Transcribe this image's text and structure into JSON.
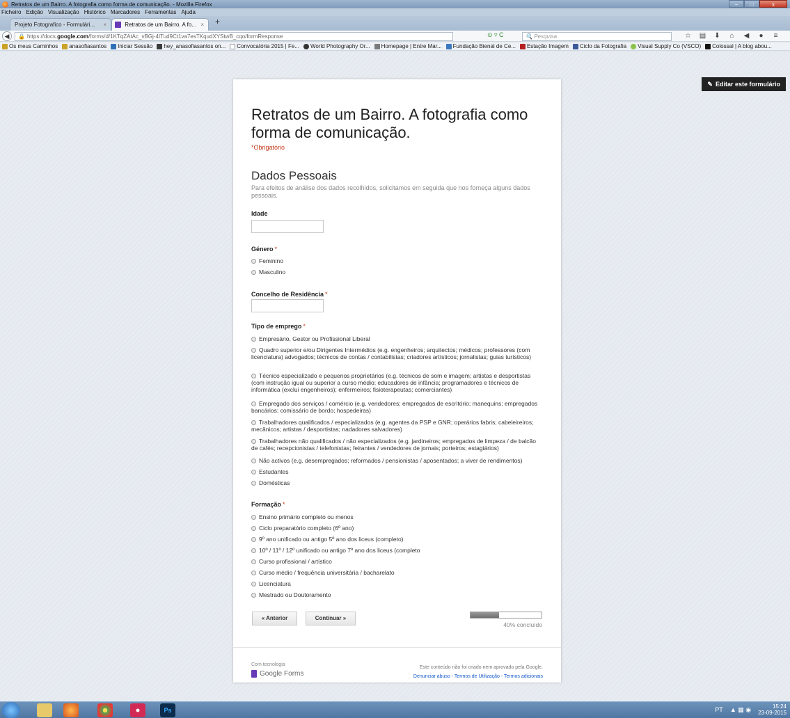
{
  "window": {
    "title": "Retratos de um Bairro. A fotografia como forma de comunicação. - Mozilla Firefox",
    "min": "–",
    "max": "□",
    "close": "x"
  },
  "menu": [
    "Ficheiro",
    "Edição",
    "Visualização",
    "Histórico",
    "Marcadores",
    "Ferramentas",
    "Ajuda"
  ],
  "tabs": [
    {
      "label": "Projeto Fotografico - Formulári..."
    },
    {
      "label": "Retratos de um Bairro. A fo..."
    }
  ],
  "tab_close": "×",
  "new_tab": "+",
  "nav": {
    "back_icon": "arrow-left",
    "url_prefix": "https://docs.",
    "url_domain": "google.com",
    "url_rest": "/forms/d/1KTqZAtAc_vBGj-4ITud9Ct1va7esTKqudXYStwB_cqo/formResponse",
    "url_actions": "⊙ ▿ C",
    "search_placeholder": "Pesquisa",
    "icons": [
      "☆",
      "▤",
      "⬇",
      "⌂",
      "◀",
      "●",
      "≡"
    ]
  },
  "bookmarks": [
    {
      "label": "Os meus Caminhos",
      "color": "#c9a227"
    },
    {
      "label": "anasofiasantos",
      "color": "#c9a227"
    },
    {
      "label": "Iniciar Sessão",
      "color": "#2f6fb8"
    },
    {
      "label": "hey_anasofiasantos on...",
      "color": "#3b3b3b"
    },
    {
      "label": "Convocatória 2015 | Fe...",
      "color": "#ffffff"
    },
    {
      "label": "World Photography Or...",
      "color": "#333333"
    },
    {
      "label": "Homepage | Entre Mar...",
      "color": "#7a7a7a"
    },
    {
      "label": "Fundação Bienal de Ce...",
      "color": "#3b78c2"
    },
    {
      "label": "Estação Imagem",
      "color": "#b52020"
    },
    {
      "label": "Ciclo da Fotografia",
      "color": "#3b5998"
    },
    {
      "label": "Visual Supply Co (VSCO)",
      "color": "#8bc34a"
    },
    {
      "label": "Colossal | A blog abou...",
      "color": "#111111"
    }
  ],
  "edit_button": "Editar este formulário",
  "form": {
    "title": "Retratos de um Bairro. A fotografia como forma de comunicação.",
    "required_note": "*Obrigatório",
    "section_title": "Dados Pessoais",
    "section_desc": "Para efeitos de análise dos dados recolhidos, solicitamos em seguida que nos forneça alguns dados pessoais.",
    "required_mark": "*",
    "q_idade": {
      "label": "Idade",
      "value": ""
    },
    "q_genero": {
      "label": "Género",
      "options": [
        "Feminino",
        "Masculino"
      ]
    },
    "q_concelho": {
      "label": "Concelho de Residência",
      "value": ""
    },
    "q_emprego": {
      "label": "Tipo de emprego",
      "options": [
        "Empresário, Gestor ou Profissional Liberal",
        "Quadro superior e/ou Dirigentes Intermédios (e.g. engenheiros; arquitectos; médicos; professores (com licenciatura) advogados; técnicos de contas / contabilistas; criadores artísticos; jornalistas; guias turísticos)",
        "Técnico especializado e pequenos proprietários (e.g. técnicos de som e imagem; artistas e desportistas (com instrução igual ou superior a curso médio; educadores de infância; programadores e técnicos de informática (exclui engenheiros); enfermeiros; fisioterapeutas; comerciantes)",
        "Empregado dos serviços / comércio (e.g. vendedores; empregados de escritório; manequins; empregados bancários; comissário de bordo; hospedeiras)",
        "Trabalhadores qualificados / especializados (e.g. agentes da PSP e GNR; operários fabris; cabeleireiros; mecânicos; artistas / desportistas; nadadores salvadores)",
        "Trabalhadores não qualificados / não especializados (e.g. jardineiros; empregados de limpeza / de balcão de cafés; recepcionistas / telefonistas; feirantes / vendedores de jornais; porteiros; estagiários)",
        "Não activos (e.g. desempregados; reformados / pensionistas / aposentados; a viver de rendimentos)",
        "Estudantes",
        "Domésticas"
      ]
    },
    "q_formacao": {
      "label": "Formação",
      "options": [
        "Ensino primário completo ou menos",
        "Ciclo preparatório completo (6º ano)",
        "9º ano unificado ou antigo 5º ano dos liceus (completo)",
        "10º / 11º / 12º unificado ou antigo 7º ano dos liceus (completo",
        "Curso profissional / artístico",
        "Curso médio / frequência universitária / bacharelato",
        "Licenciatura",
        "Mestrado ou Doutoramento"
      ]
    },
    "prev_button": "« Anterior",
    "next_button": "Continuar »",
    "progress_fraction": 0.4,
    "progress_text": "40% concluído",
    "powered_by": "Com tecnologia",
    "brand": "Google Forms",
    "disclaimer": "Este conteúdo não foi criado nem aprovado pela Google.",
    "footer_links": "Denunciar abuso - Termos de Utilização - Termos adicionais"
  },
  "taskbar": {
    "apps": [
      {
        "name": "file-explorer-icon",
        "color": "#e8c96a"
      },
      {
        "name": "firefox-icon",
        "color": "#e0742b"
      },
      {
        "name": "chrome-icon",
        "color": "#4caf50"
      },
      {
        "name": "itunes-icon",
        "color": "#d12a55"
      },
      {
        "name": "photoshop-icon",
        "color": "#0d2b4a"
      }
    ],
    "ps_label": "Ps",
    "lang": "PT",
    "time": "15:24",
    "date": "23-09-2015"
  }
}
